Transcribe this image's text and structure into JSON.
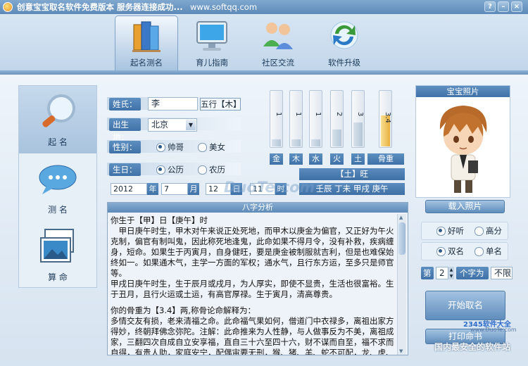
{
  "window": {
    "title": "创意宝宝取名软件免费版本 服务器连接成功...",
    "site": "www.softqq.com",
    "help_btn": "?",
    "min_btn": "–",
    "close_btn": "×"
  },
  "toolbar": [
    {
      "label": "起名测名",
      "icon": "books-icon",
      "active": true
    },
    {
      "label": "育儿指南",
      "icon": "monitor-icon"
    },
    {
      "label": "社区交流",
      "icon": "users-icon"
    },
    {
      "label": "软件升级",
      "icon": "refresh-icon"
    }
  ],
  "sidebar": [
    {
      "label": "起 名",
      "icon": "magnifier-icon"
    },
    {
      "label": "测 名",
      "icon": "chat-bubble-icon"
    },
    {
      "label": "算 命",
      "icon": "picture-frames-icon"
    }
  ],
  "form": {
    "surname_label": "姓氏：",
    "surname_value": "李",
    "element_badge": "五行【木】",
    "birthplace_label": "出生地：",
    "birthplace_value": "北京",
    "gender_label": "性别：",
    "gender_male": "帅哥",
    "gender_female": "美女",
    "birthday_label": "生日：",
    "calendar_solar": "公历",
    "calendar_lunar": "农历",
    "year_value": "2012",
    "year_unit": "年",
    "month_value": "7",
    "month_unit": "月",
    "day_value": "12",
    "day_unit": "日",
    "hour_value": "11",
    "hour_unit": "时"
  },
  "elements": {
    "bars": [
      {
        "label": "金",
        "value": "1",
        "level": 0.12
      },
      {
        "label": "木",
        "value": "1",
        "level": 0.12
      },
      {
        "label": "水",
        "value": "1",
        "level": 0.12
      },
      {
        "label": "火",
        "value": "2",
        "level": 0.3
      },
      {
        "label": "土",
        "value": "3",
        "level": 0.42
      },
      {
        "label": "骨重",
        "value": "3.4",
        "level": 0.55
      }
    ],
    "status": "【土】旺",
    "bazi": "壬辰 丁未 甲戌 庚午"
  },
  "analysis": {
    "title": "八字分析",
    "paragraphs": [
      "你生于【甲】日【庚午】时",
      "　甲日庚午时生，甲木对午来说正处死地，而甲木以庚金为偏官，又正好为午火克制，偏官有制叫鬼，因此称死地逢鬼，此命如果不得月令，没有补救，疾病缠身，短命。如果生于丙寅月，自身健旺，要是庚金被制服就吉利，但是也难保始终如一。如果通木气，主学一方面的军权；通水气，且行东方运，至多只是师官等。",
      "甲戌日庚午时生，生于辰月或戌月，为人厚实，即使不显贵，生活也很富裕。生于丑月，且行火运或土运，有高官厚禄。生于寅月，清高尊贵。",
      "你的骨重为【3.4】两,称骨论命解释为：",
      "多情交友有损，老来清福之命。此命福气果如何，僧道门中衣禄多，离祖出家方得妙，终朝拜佛念弥陀。注解：此命推来为人性静，与人做事反为不美，离祖成家，三翻四次自成自立安享福，直自三十六至四十六，财不谋而自至，福不求而自得，有贵人助，家庭安宁，配偶宙要无刑，猴、猪、羊、蛇不可配，龙、虎、"
    ]
  },
  "photo": {
    "title": "宝宝照片",
    "load_button": "载入照片"
  },
  "options": {
    "sound_good": "好听",
    "score_high": "高分",
    "double_name": "双名",
    "single_name": "单名",
    "position_prefix": "第",
    "position_value": "2",
    "position_suffix": "个字为",
    "position_limit": "不限"
  },
  "actions": {
    "start_button": "开始取名",
    "print_button": "打印命书"
  },
  "watermarks": {
    "duote": "DuoTe.com",
    "brand": "2345软件大全",
    "brand_site": "www.DuoTe.com",
    "slogan": "国内最安全的软件站"
  }
}
